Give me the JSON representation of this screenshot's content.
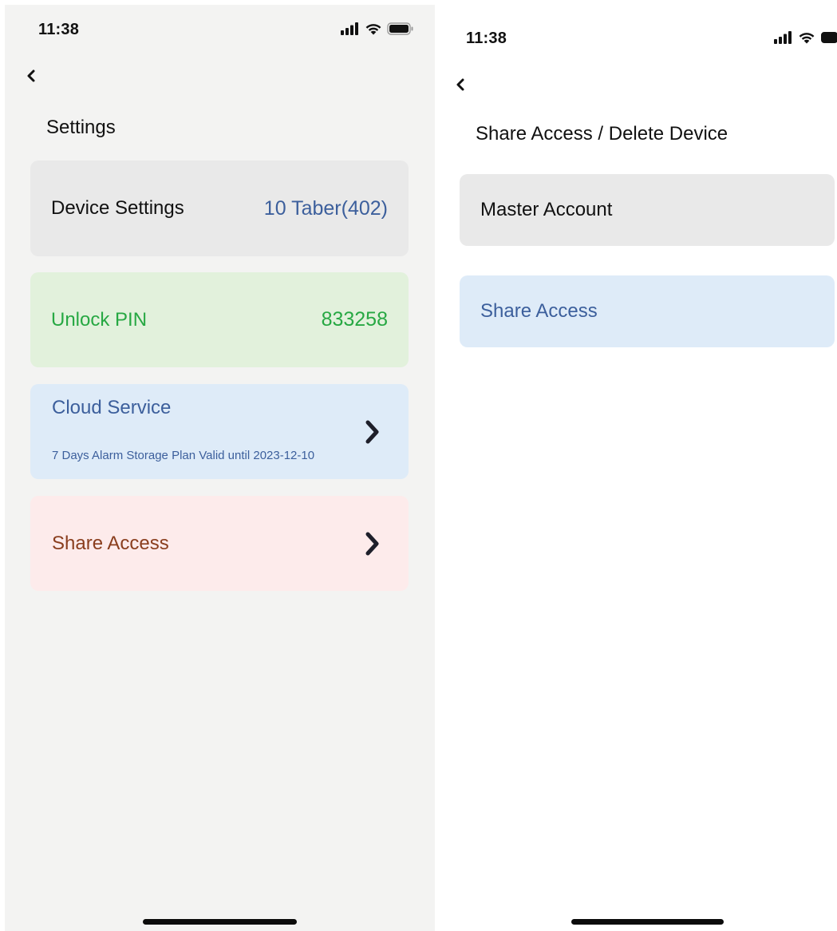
{
  "left": {
    "status": {
      "time": "11:38"
    },
    "title": "Settings",
    "cards": {
      "device": {
        "label": "Device Settings",
        "value": "10 Taber(402)"
      },
      "pin": {
        "label": "Unlock PIN",
        "value": "833258"
      },
      "cloud": {
        "label": "Cloud Service",
        "subtitle": "7 Days Alarm Storage Plan Valid until 2023-12-10"
      },
      "share": {
        "label": "Share Access"
      }
    }
  },
  "right": {
    "status": {
      "time": "11:38"
    },
    "title": "Share Access / Delete Device",
    "cards": {
      "master": {
        "label": "Master Account"
      },
      "share": {
        "label": "Share Access"
      }
    }
  },
  "colors": {
    "left_bg": "#f3f3f2",
    "card_gray": "#e9e9e9",
    "card_green": "#e2f1dc",
    "green_text": "#27a843",
    "card_blue": "#deebf8",
    "blue_text": "#3c5f9c",
    "card_pink": "#fdebeb",
    "brown_text": "#8a3e1e"
  }
}
